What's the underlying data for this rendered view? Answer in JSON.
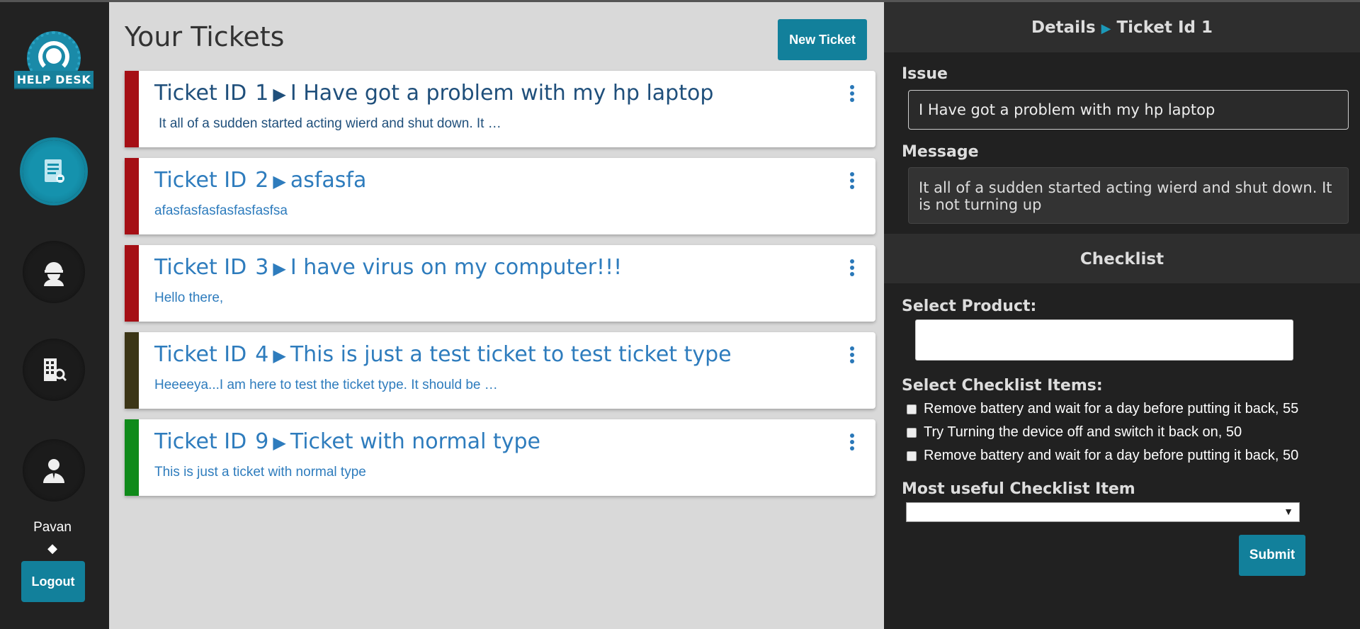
{
  "sidebar": {
    "logo_text": "HELP DESK",
    "nav": [
      {
        "icon": "ticket-list-icon"
      },
      {
        "icon": "agent-icon"
      },
      {
        "icon": "building-search-icon"
      },
      {
        "icon": "user-icon"
      }
    ],
    "user_name": "Pavan",
    "user_separator": "◆",
    "logout_label": "Logout"
  },
  "main": {
    "title": "Your Tickets",
    "new_ticket_label": "New Ticket",
    "tickets": [
      {
        "id_label": "Ticket ID",
        "id": "1",
        "arrow": "▶",
        "title": "I Have got a problem with my hp laptop",
        "preview": "It all of a sudden started acting wierd and shut down. It …",
        "color": "#a50f15",
        "selected": true
      },
      {
        "id_label": "Ticket ID",
        "id": "2",
        "arrow": "▶",
        "title": "asfasfa",
        "preview": "afasfasfasfasfasfasfsa",
        "color": "#a50f15",
        "selected": false
      },
      {
        "id_label": "Ticket ID",
        "id": "3",
        "arrow": "▶",
        "title": "I have virus on my computer!!!",
        "preview": "Hello there,",
        "color": "#a50f15",
        "selected": false
      },
      {
        "id_label": "Ticket ID",
        "id": "4",
        "arrow": "▶",
        "title": "This is just a test ticket to test ticket type",
        "preview": "Heeeeya...I am here to test the ticket type. It should be …",
        "color": "#3b3516",
        "selected": false
      },
      {
        "id_label": "Ticket ID",
        "id": "9",
        "arrow": "▶",
        "title": "Ticket with normal type",
        "preview": "This is just a ticket with normal type",
        "color": "#0f8a1a",
        "selected": false
      }
    ]
  },
  "details": {
    "header_label": "Details",
    "header_arrow": "▶",
    "header_ticket": "Ticket Id 1",
    "issue_label": "Issue",
    "issue_value": "I Have got a problem with my hp laptop",
    "message_label": "Message",
    "message_value": "It all of a sudden started acting wierd and shut down. It is not turning up"
  },
  "checklist": {
    "header": "Checklist",
    "product_label": "Select Product:",
    "product_value": "",
    "items_label": "Select Checklist Items:",
    "items": [
      "Remove battery and wait for a day before putting it back, 55",
      "Try Turning the device off and switch it back on, 50",
      "Remove battery and wait for a day before putting it back, 50"
    ],
    "most_useful_label": "Most useful Checklist Item",
    "most_useful_value": "",
    "submit_label": "Submit"
  },
  "colors": {
    "accent": "#12809b",
    "sidebar_bg": "#222222",
    "panel_bg": "#212121",
    "link_blue": "#2e7cbd"
  }
}
